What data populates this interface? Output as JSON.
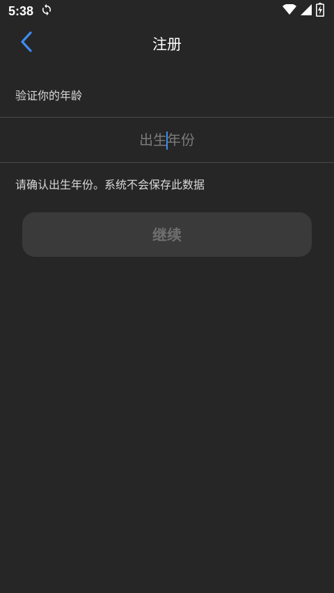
{
  "status_bar": {
    "time": "5:38",
    "icons": [
      "sync-icon",
      "wifi-icon",
      "signal-icon",
      "battery-charging-icon"
    ]
  },
  "header": {
    "title": "注册",
    "back_icon": "chevron-left-icon"
  },
  "form": {
    "section_label": "验证你的年龄",
    "year_input": {
      "placeholder": "出生年份",
      "value": ""
    },
    "hint": "请确认出生年份。系统不会保存此数据",
    "continue_label": "继续"
  },
  "colors": {
    "background": "#262626",
    "accent": "#3d8ef0",
    "button_bg": "#3a3a3a",
    "button_text_disabled": "#6f6f6f"
  }
}
